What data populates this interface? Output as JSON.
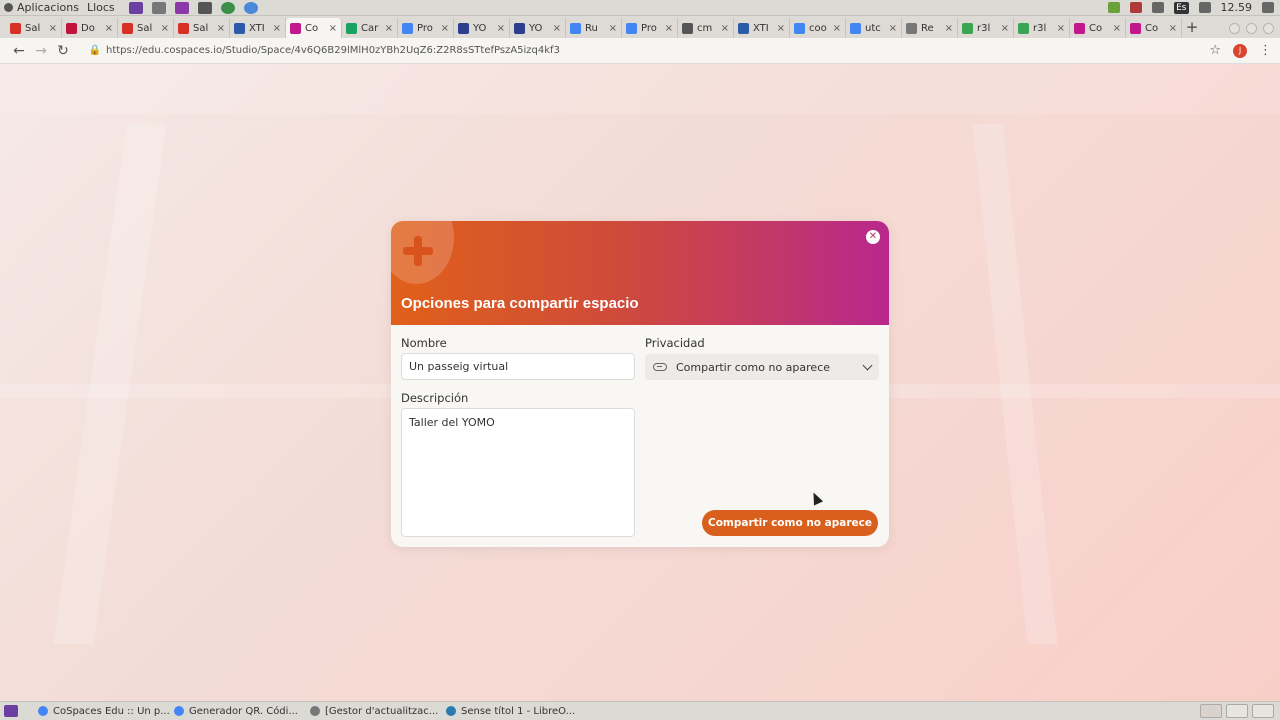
{
  "os_bar": {
    "apps_label": "Aplicacions",
    "places_label": "Llocs",
    "clock": "12.59",
    "keyboard_layout": "Es"
  },
  "tabs": [
    {
      "title": "Sal",
      "icon": "gmail-icon",
      "color": "#d93025"
    },
    {
      "title": "Do",
      "icon": "record-icon",
      "color": "#c0143c"
    },
    {
      "title": "Sal",
      "icon": "gmail-icon",
      "color": "#d93025"
    },
    {
      "title": "Sal",
      "icon": "gmail-icon",
      "color": "#d93025"
    },
    {
      "title": "XTI",
      "icon": "calendar-icon",
      "color": "#2a5caa"
    },
    {
      "title": "Co",
      "icon": "cospaces-icon",
      "color": "#c2188b"
    },
    {
      "title": "Car",
      "icon": "drive-icon",
      "color": "#1aa260"
    },
    {
      "title": "Pro",
      "icon": "docs-icon",
      "color": "#4285f4"
    },
    {
      "title": "YO",
      "icon": "forms-icon",
      "color": "#2c3e8c"
    },
    {
      "title": "YO",
      "icon": "forms-icon",
      "color": "#2c3e8c"
    },
    {
      "title": "Ru",
      "icon": "docs-icon",
      "color": "#4285f4"
    },
    {
      "title": "Pro",
      "icon": "docs-icon",
      "color": "#4285f4"
    },
    {
      "title": "cm",
      "icon": "image-icon",
      "color": "#555555"
    },
    {
      "title": "XTI",
      "icon": "calendar-icon",
      "color": "#2a5caa"
    },
    {
      "title": "coo",
      "icon": "google-icon",
      "color": "#4285f4"
    },
    {
      "title": "utc",
      "icon": "google-icon",
      "color": "#4285f4"
    },
    {
      "title": "Re",
      "icon": "page-icon",
      "color": "#777777"
    },
    {
      "title": "r3l",
      "icon": "leaf-icon",
      "color": "#3aa655"
    },
    {
      "title": "r3l",
      "icon": "leaf-icon",
      "color": "#3aa655"
    },
    {
      "title": "Co",
      "icon": "cospaces-icon",
      "color": "#c2188b"
    },
    {
      "title": "Co",
      "icon": "cospaces-icon",
      "color": "#c2188b"
    }
  ],
  "active_tab_index": 5,
  "address_bar": {
    "url": "https://edu.cospaces.io/Studio/Space/4v6Q6B29lMlH0zYBh2UqZ6:Z2R8sSTtefPszA5izq4kf3",
    "profile_initial": "J"
  },
  "dialog": {
    "title": "Opciones para compartir espacio",
    "name_label": "Nombre",
    "name_value": "Un passeig virtual",
    "privacy_label": "Privacidad",
    "privacy_value": "Compartir como no aparece",
    "description_label": "Descripción",
    "description_value": "Taller del YOMO",
    "share_button": "Compartir como no aparece",
    "accent_color": "#d9601c",
    "header_gradient": [
      "#e0601a",
      "#cf4b3a",
      "#b8288c"
    ]
  },
  "taskbar": {
    "items": [
      {
        "label": "CoSpaces Edu :: Un p...",
        "color": "#4285f4"
      },
      {
        "label": "Generador QR. Códi...",
        "color": "#4285f4"
      },
      {
        "label": "[Gestor d'actualitzac...",
        "color": "#777777"
      },
      {
        "label": "Sense títol 1 - LibreO...",
        "color": "#2a7ab0"
      }
    ]
  }
}
